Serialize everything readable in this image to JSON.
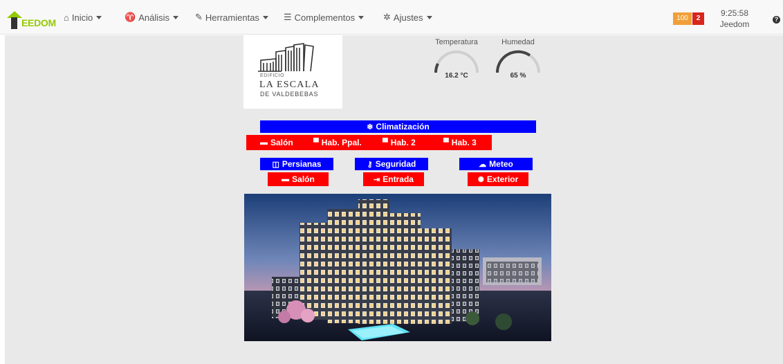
{
  "navbar": {
    "brand_text": "EEDOM",
    "items": [
      {
        "label": "Inicio",
        "icon": "home-icon"
      },
      {
        "label": "Análisis",
        "icon": "stethoscope-icon"
      },
      {
        "label": "Herramientas",
        "icon": "wrench-icon"
      },
      {
        "label": "Complementos",
        "icon": "list-icon"
      },
      {
        "label": "Ajustes",
        "icon": "cogs-icon"
      }
    ],
    "badge_warning": "100",
    "badge_alert": "2",
    "time": "9:25:58",
    "user": "Jeedom",
    "help_icon": "question-circle-icon"
  },
  "logo": {
    "small": "EDIFICIO",
    "main": "LA ESCALA",
    "sub": "DE VALDEBEBAS"
  },
  "gauges": [
    {
      "title": "Temperatura",
      "value": "16.2 °C"
    },
    {
      "title": "Humedad",
      "value": "65 %",
      "level_percent": 65
    }
  ],
  "climatizacion": {
    "label": "Climatización",
    "rooms": [
      "Salón",
      "Hab. Ppal.",
      "Hab. 2",
      "Hab. 3"
    ]
  },
  "persianas": {
    "label": "Persianas",
    "sub": "Salón"
  },
  "seguridad": {
    "label": "Seguridad",
    "sub": "Entrada"
  },
  "meteo": {
    "label": "Meteo",
    "sub": "Exterior"
  },
  "colors": {
    "blue": "#0000ff",
    "red": "#ff0000",
    "brand": "#94ca02",
    "warning": "#f0a038",
    "alert": "#d9251c"
  }
}
